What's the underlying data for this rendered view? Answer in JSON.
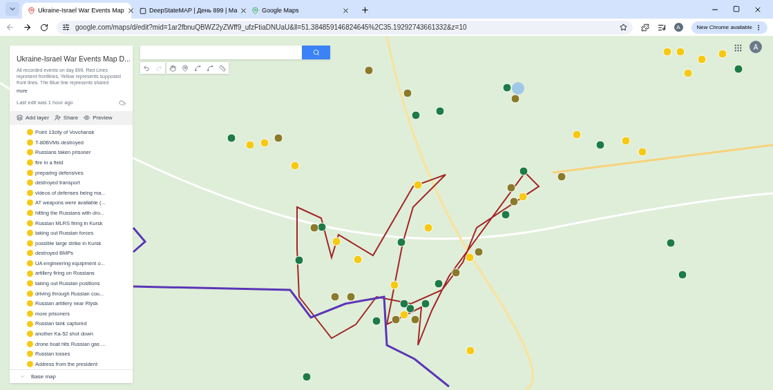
{
  "browser": {
    "tabs": [
      {
        "title": "Ukraine-Israel War Events Map",
        "selected": true
      },
      {
        "title": "DeepStateMAP | День 899 | Ма",
        "selected": false
      },
      {
        "title": "Google Maps",
        "selected": false
      }
    ],
    "url": "google.com/maps/d/edit?mid=1ar2fbnuQBWZ2yZWff9_ufzFtiaDNUaU&ll=51.384859146824645%2C35.19292743661332&z=10",
    "update_button": "New Chrome available",
    "profile_initial": "A"
  },
  "panel": {
    "title": "Ukraine-Israel War Events Map D...",
    "description": "All recorded events on day 899. Red Lines represent frontlines, Yellow represents supposed front lines. The Blue line represents shared",
    "more": "more",
    "last_edit": "Last edit was 1 hour ago",
    "actions": [
      "Add layer",
      "Share",
      "Preview"
    ],
    "items": [
      "Point 13city of Vovchansk",
      "T-80BVMs destroyed",
      "Russians taken prisoner",
      "fire in a field",
      "preparing defensives",
      "destroyed transport",
      "videos of defenses being ma...",
      "AT weapons were available (...",
      "hitting the Russians with dro...",
      "Russian MLRS firing in Kursk",
      "taking out Russian forces",
      "possible large strike in Kursk",
      "destroyed BMPs",
      "UA engineering equipment o...",
      "artillery firing on Russians",
      "taking out Russian positions",
      "driving through Russian cou...",
      "Russian artillery near Rlysk",
      "more prisoners",
      "Russian tank captured",
      "another Ka-52 shot down",
      "drone boat hits Russian gas ...",
      "Russian losses",
      "Address from the president"
    ],
    "base_map": "Base map"
  },
  "map": {
    "account_initial": "A"
  }
}
